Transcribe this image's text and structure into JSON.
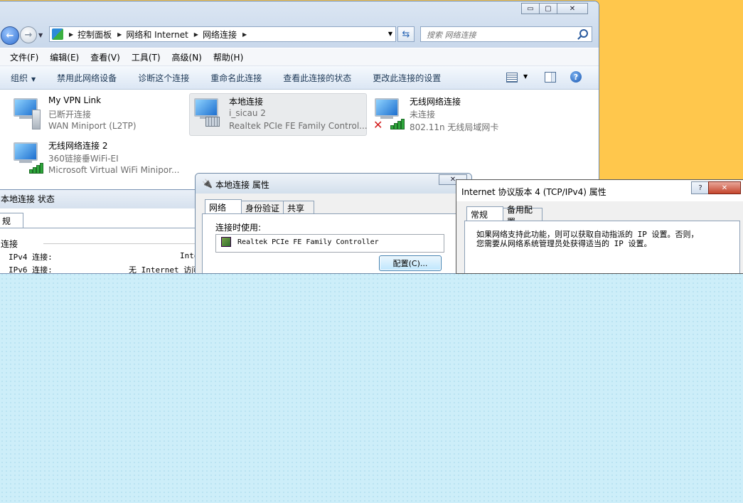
{
  "explorer": {
    "caption_buttons": {
      "minimize": "▭",
      "maximize": "▢",
      "close": "✕"
    },
    "address_crumbs": [
      "控制面板",
      "网络和 Internet",
      "网络连接"
    ],
    "search_placeholder": "搜索 网络连接",
    "menu": [
      "文件(F)",
      "编辑(E)",
      "查看(V)",
      "工具(T)",
      "高级(N)",
      "帮助(H)"
    ],
    "commands": [
      "组织",
      "禁用此网络设备",
      "诊断这个连接",
      "重命名此连接",
      "查看此连接的状态",
      "更改此连接的设置"
    ],
    "help_label": "?",
    "connections": [
      {
        "name": "My VPN Link",
        "status": "已断开连接",
        "device": "WAN Miniport (L2TP)"
      },
      {
        "name": "本地连接",
        "status": "i_sicau  2",
        "device": "Realtek PCIe FE Family Control..."
      },
      {
        "name": "无线网络连接",
        "status": "未连接",
        "device": "802.11n 无线局域网卡"
      },
      {
        "name": "无线网络连接 2",
        "status": "360链接垂WiFi-EI",
        "device": "Microsoft Virtual WiFi Minipor..."
      }
    ]
  },
  "status_window": {
    "title": "本地连接 状态",
    "tab": "规",
    "section": "连接",
    "ipv4_label": "IPv4 连接:",
    "ipv4_value": "Inte",
    "ipv6_label": "IPv6 连接:",
    "ipv6_value": "无 Internet 访问"
  },
  "props_window": {
    "title": "本地连接 属性",
    "close": "✕",
    "tabs": [
      "网络",
      "身份验证",
      "共享"
    ],
    "connect_using_label": "连接时使用:",
    "adapter": "Realtek PCIe FE Family Controller",
    "config_button": "配置(C)..."
  },
  "tcp_window": {
    "title": "Internet 协议版本 4 (TCP/IPv4) 属性",
    "help": "?",
    "close": "✕",
    "tabs": [
      "常规",
      "备用配置"
    ],
    "description_line1": "如果网络支持此功能，则可以获取自动指派的 IP 设置。否则，",
    "description_line2": "您需要从网络系统管理员处获得适当的 IP 设置。"
  }
}
